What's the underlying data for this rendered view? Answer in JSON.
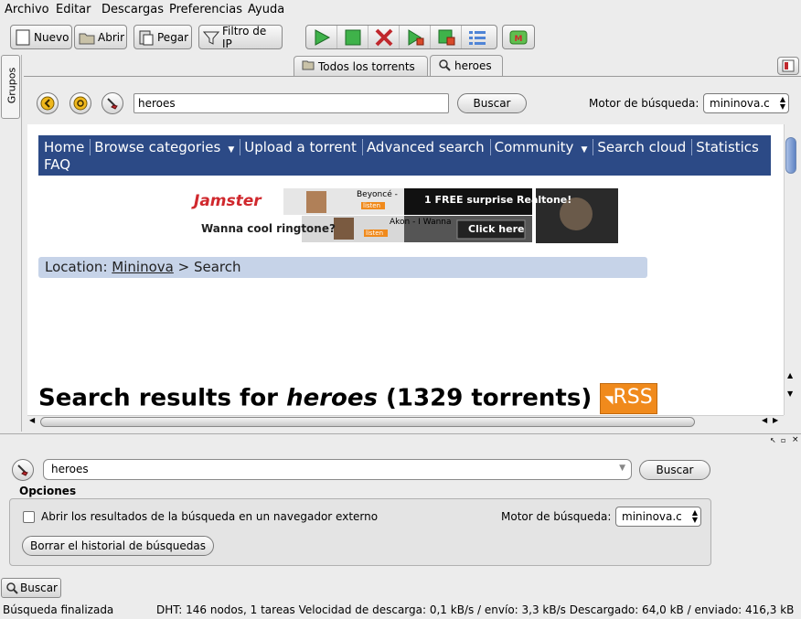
{
  "menubar": {
    "items": [
      {
        "label": "Archivo",
        "key": "A",
        "rest": "rchivo"
      },
      {
        "label": "Editar",
        "key": "E",
        "rest": "ditar"
      },
      {
        "label": "Descargas",
        "key": "D",
        "rest": "escargas"
      },
      {
        "label": "Preferencias",
        "key": "P",
        "rest": "referencias"
      },
      {
        "label": "Ayuda",
        "key": "A",
        "rest": "yuda"
      }
    ]
  },
  "toolbar": {
    "new_label": "Nuevo",
    "open_label": "Abrir",
    "paste_label": "Pegar",
    "ipfilter_label": "Filtro de IP"
  },
  "sidebar": {
    "groups_label": "Grupos"
  },
  "tabs": [
    {
      "label": "Todos los torrents",
      "icon": "folder-icon"
    },
    {
      "label": "heroes",
      "icon": "magnifier-icon"
    }
  ],
  "top_search": {
    "query": "heroes",
    "button": "Buscar",
    "engine_label": "Motor de búsqueda:",
    "engine_value": "mininova.c"
  },
  "webpage": {
    "nav_row1": [
      "Home",
      "Browse categories",
      "Upload a torrent",
      "Advanced search",
      "Community",
      "Search cloud",
      "Statistics"
    ],
    "nav_row2": [
      "FAQ"
    ],
    "ad": {
      "brand": "Jamster",
      "tagline": "Wanna cool ringtone?",
      "song1": "Beyoncé -",
      "song2": "Akon - I Wanna",
      "offer": "1 FREE surprise Realtone!",
      "cta": "Click here",
      "listen": "listen"
    },
    "location_label": "Location:",
    "location_link": "Mininova",
    "location_rest": "> Search",
    "results_prefix": "Search results for ",
    "results_query": "heroes",
    "results_count": " (1329 torrents)",
    "rss": "RSS"
  },
  "bottom_search": {
    "query": "heroes",
    "button": "Buscar",
    "options_title": "Opciones",
    "open_external": "Abrir los resultados de la búsqueda en un navegador externo",
    "engine_label": "Motor de búsqueda:",
    "engine_value": "mininova.c",
    "clear_history": "Borrar el historial de búsquedas"
  },
  "bottom_tab": {
    "label": "Buscar"
  },
  "status": {
    "left": "Búsqueda finalizada",
    "right": "DHT: 146 nodos, 1 tareas Velocidad de descarga: 0,1 kB/s / envío: 3,3 kB/s Descargado: 64,0 kB / enviado: 416,3 kB"
  }
}
